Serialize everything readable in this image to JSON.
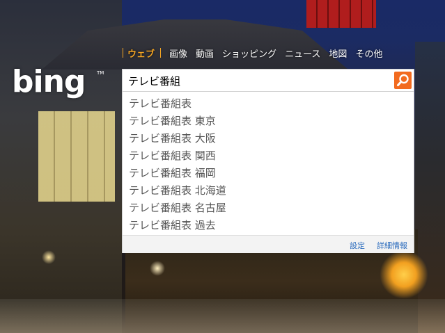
{
  "nav": {
    "items": [
      {
        "label": "ウェブ",
        "active": true
      },
      {
        "label": "画像"
      },
      {
        "label": "動画"
      },
      {
        "label": "ショッピング"
      },
      {
        "label": "ニュース"
      },
      {
        "label": "地図"
      },
      {
        "label": "その他"
      }
    ]
  },
  "logo": {
    "text": "bing",
    "tm": "TM"
  },
  "search": {
    "query": "テレビ番組",
    "button_icon": "search-icon"
  },
  "suggestions": [
    "テレビ番組表",
    "テレビ番組表 東京",
    "テレビ番組表 大阪",
    "テレビ番組表 関西",
    "テレビ番組表 福岡",
    "テレビ番組表 北海道",
    "テレビ番組表 名古屋",
    "テレビ番組表 過去"
  ],
  "suggest_footer": {
    "settings": "設定",
    "details": "詳細情報"
  },
  "colors": {
    "accent_orange": "#f5a623",
    "search_button": "#f26b1f",
    "link_blue": "#2a6bbd"
  }
}
